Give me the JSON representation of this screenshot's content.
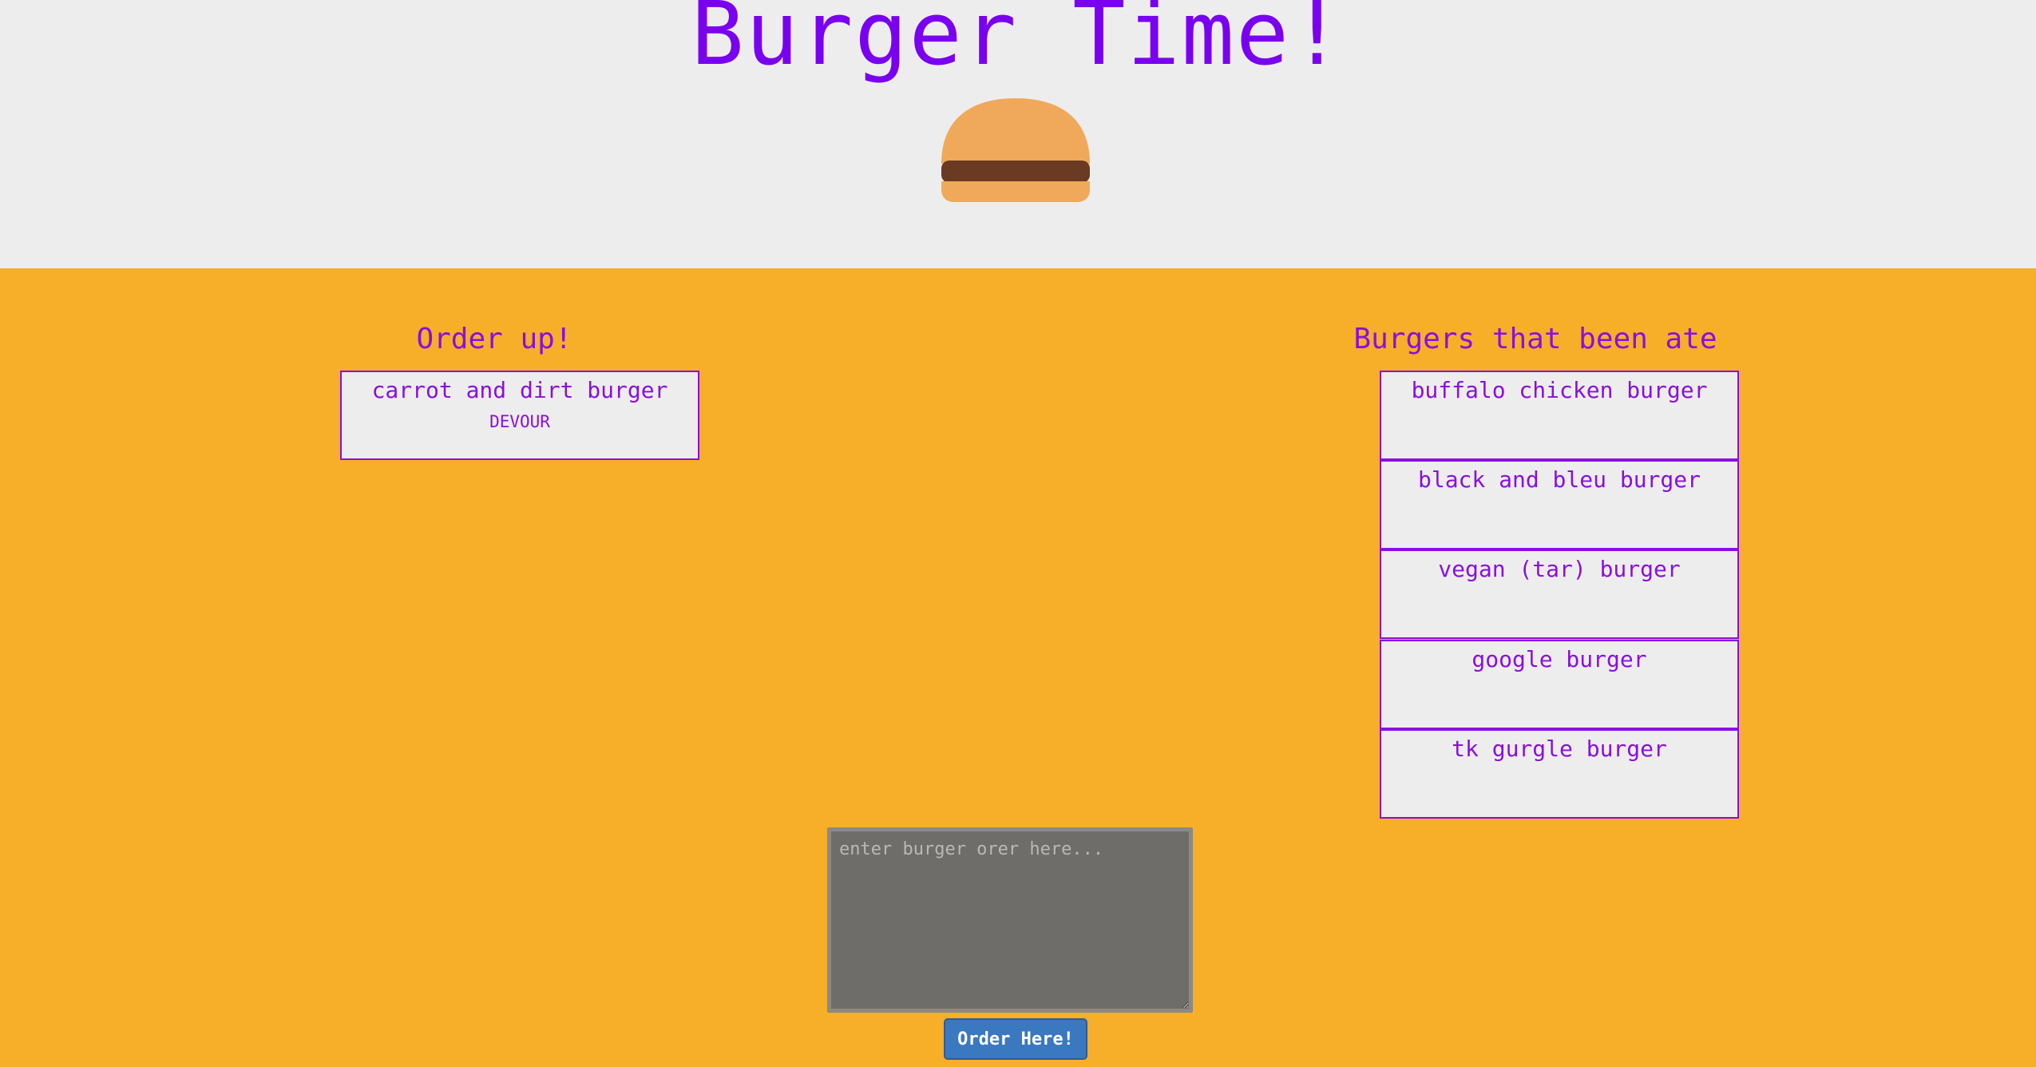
{
  "header": {
    "title": "Burger Time!",
    "logo_icon": "burger-icon",
    "colors": {
      "background": "#eeeded",
      "title": "#7a00f0",
      "bun": "#f0a95a",
      "patty": "#6b3a22"
    }
  },
  "main": {
    "background": "#f7ae28",
    "accent": "#8a0fe0"
  },
  "order_up": {
    "heading": "Order up!",
    "items": [
      {
        "name": "carrot and dirt burger",
        "action": "DEVOUR"
      }
    ]
  },
  "eaten": {
    "heading": "Burgers that been ate",
    "items": [
      {
        "name": "buffalo chicken burger"
      },
      {
        "name": "black and bleu burger"
      },
      {
        "name": "vegan (tar) burger"
      },
      {
        "name": "google burger"
      },
      {
        "name": "tk gurgle burger"
      }
    ]
  },
  "order_form": {
    "placeholder": "enter burger orer here...",
    "value": "",
    "submit_label": "Order Here!",
    "button_color": "#3a78c0"
  }
}
